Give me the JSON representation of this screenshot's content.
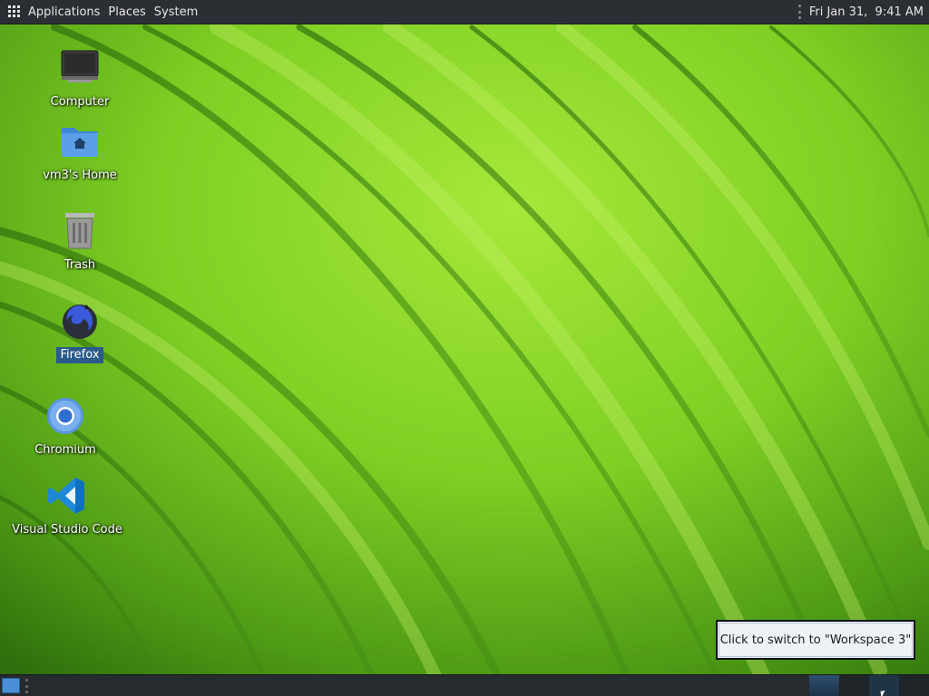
{
  "top_panel": {
    "menu_icon": "apps-grid-icon",
    "menus": [
      "Applications",
      "Places",
      "System"
    ],
    "clock": "Fri Jan 31,  9:41 AM"
  },
  "desktop_icons": [
    {
      "label": "Computer",
      "icon": "computer-icon",
      "selected": false
    },
    {
      "label": "vm3's Home",
      "icon": "home-folder-icon",
      "selected": false
    },
    {
      "label": "Trash",
      "icon": "trash-icon",
      "selected": false
    },
    {
      "label": "Firefox",
      "icon": "firefox-icon",
      "selected": true
    },
    {
      "label": "Chromium",
      "icon": "chromium-icon",
      "selected": false
    },
    {
      "label": "Visual Studio Code",
      "icon": "vscode-icon",
      "selected": false
    }
  ],
  "tooltip": {
    "text": "Click to switch to \"Workspace 3\""
  },
  "bottom_panel": {
    "show_desktop_icon": "show-desktop-icon",
    "workspaces_count": 4
  },
  "colors": {
    "panel_bg": "#2a2f34",
    "wallpaper_green": "#6fbf1e",
    "selection_blue": "#2a5b8a",
    "tooltip_bg": "#edf2f7"
  }
}
